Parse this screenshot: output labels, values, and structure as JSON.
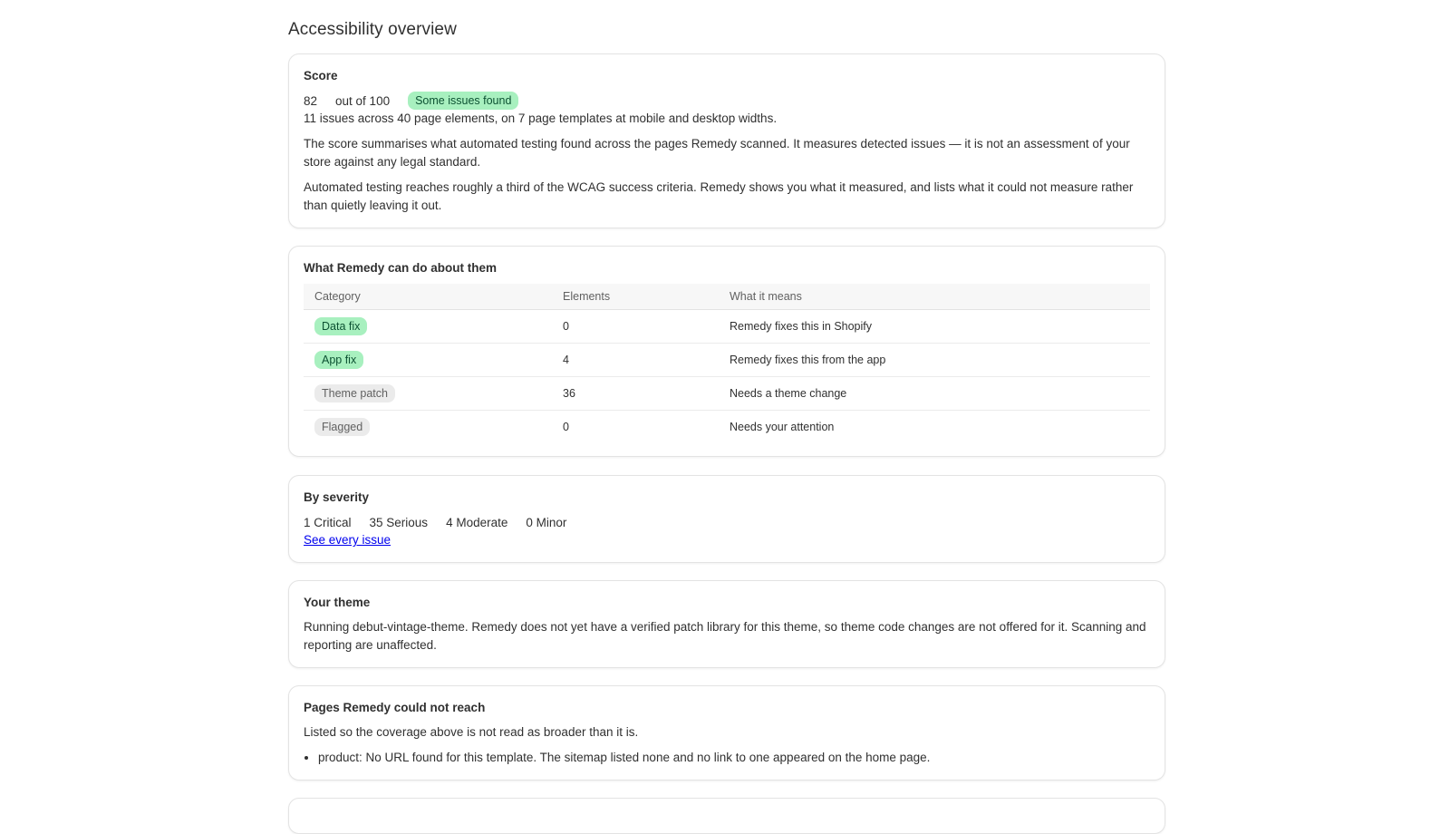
{
  "page": {
    "title": "Accessibility overview"
  },
  "score": {
    "title": "Score",
    "value": "82",
    "out_of": "out of 100",
    "badge": "Some issues found",
    "summary": "11 issues across 40 page elements, on 7 page templates at mobile and desktop widths.",
    "para1": "The score summarises what automated testing found across the pages Remedy scanned. It measures detected issues — it is not an assessment of your store against any legal standard.",
    "para2": "Automated testing reaches roughly a third of the WCAG success criteria. Remedy shows you what it measured, and lists what it could not measure rather than quietly leaving it out."
  },
  "remedy": {
    "title": "What Remedy can do about them",
    "columns": [
      "Category",
      "Elements",
      "What it means"
    ],
    "rows": [
      {
        "category": "Data fix",
        "elements": "0",
        "meaning": "Remedy fixes this in Shopify",
        "tone": "green"
      },
      {
        "category": "App fix",
        "elements": "4",
        "meaning": "Remedy fixes this from the app",
        "tone": "green"
      },
      {
        "category": "Theme patch",
        "elements": "36",
        "meaning": "Needs a theme change",
        "tone": "gray"
      },
      {
        "category": "Flagged",
        "elements": "0",
        "meaning": "Needs your attention",
        "tone": "gray"
      }
    ]
  },
  "severity": {
    "title": "By severity",
    "critical": "1 Critical",
    "serious": "35 Serious",
    "moderate": "4 Moderate",
    "minor": "0 Minor",
    "link": "See every issue"
  },
  "theme": {
    "title": "Your theme",
    "text": "Running debut-vintage-theme. Remedy does not yet have a verified patch library for this theme, so theme code changes are not offered for it. Scanning and reporting are unaffected."
  },
  "unreached": {
    "title": "Pages Remedy could not reach",
    "intro": "Listed so the coverage above is not read as broader than it is.",
    "items": [
      "product: No URL found for this template. The sitemap listed none and no link to one appeared on the home page."
    ]
  },
  "colors": {
    "badge_green": "#a8f0bf",
    "badge_gray": "#ebebeb",
    "link": "#0000ee"
  }
}
